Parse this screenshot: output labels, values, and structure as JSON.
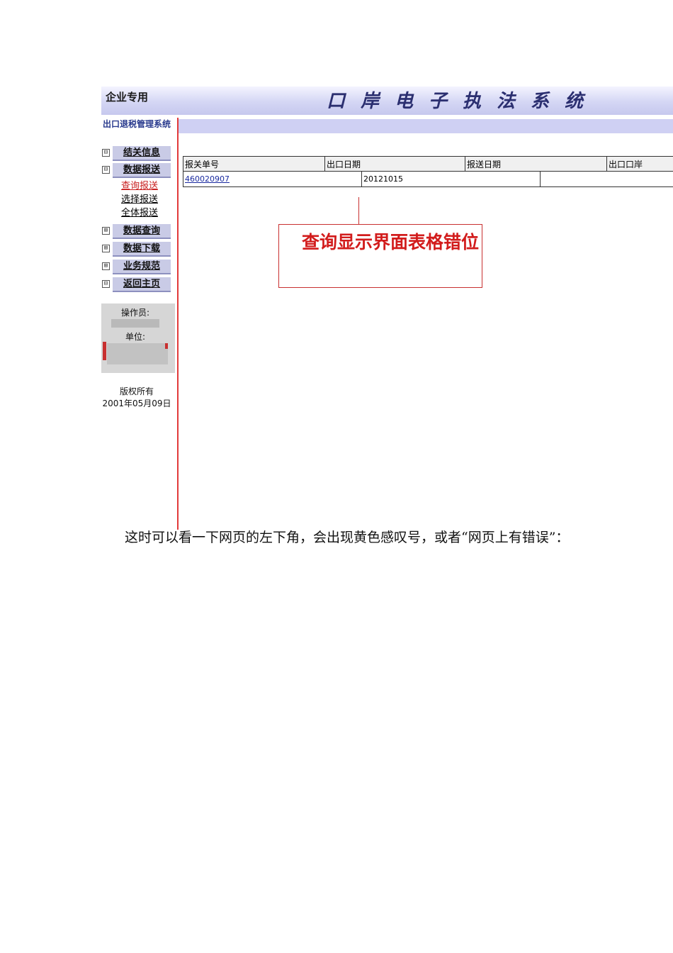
{
  "banner": {
    "left_label": "企业专用",
    "title": "口岸电子执法系统"
  },
  "sidebar": {
    "system_title": "出口退税管理系统",
    "menu": [
      {
        "toggle": "⊟",
        "label": "结关信息"
      },
      {
        "toggle": "⊟",
        "label": "数据报送"
      },
      {
        "toggle": "⊞",
        "label": "数据查询"
      },
      {
        "toggle": "⊞",
        "label": "数据下载"
      },
      {
        "toggle": "⊞",
        "label": "业务规范"
      },
      {
        "toggle": "⊟",
        "label": "返回主页"
      }
    ],
    "submenu": [
      "查询报送",
      "选择报送",
      "全体报送"
    ],
    "operator_label": "操作员:",
    "unit_label": "单位:",
    "copyright_line1": "版权所有",
    "copyright_line2": "2001年05月09日"
  },
  "table": {
    "headers": [
      "报关单号",
      "出口日期",
      "报送日期",
      "出口口岸"
    ],
    "row": {
      "declaration_no": "460020907",
      "export_date": "20121015",
      "report_date": "",
      "port": ""
    }
  },
  "annotation": {
    "text": "查询显示界面表格错位"
  },
  "paragraph": {
    "text": "这时可以看一下网页的左下角，会出现黄色感叹号，或者“网页上有错误”："
  },
  "colors": {
    "accent_red": "#c83030",
    "banner_blue": "#c6c8ee",
    "menu_button": "#c9cbe6"
  }
}
